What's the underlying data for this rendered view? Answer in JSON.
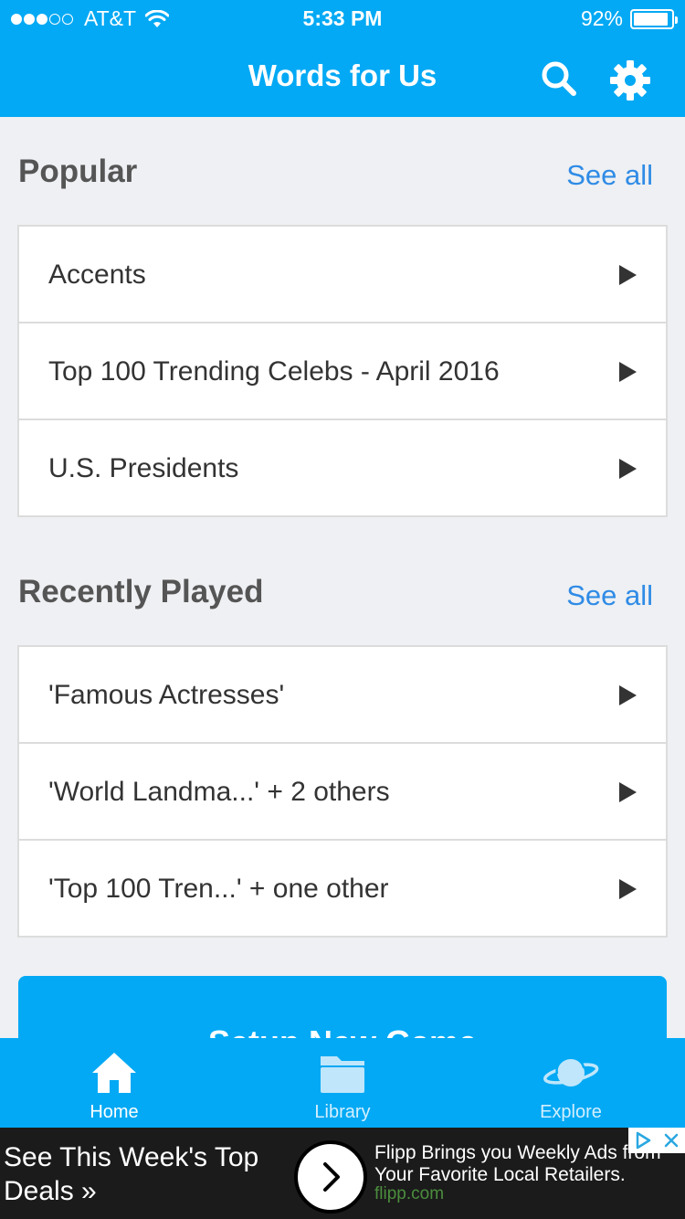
{
  "status_bar": {
    "carrier": "AT&T",
    "time": "5:33 PM",
    "battery": "92%",
    "battery_level": 0.92
  },
  "nav": {
    "title": "Words for Us"
  },
  "popular": {
    "title": "Popular",
    "see_all": "See all",
    "items": [
      {
        "label": "Accents"
      },
      {
        "label": "Top 100 Trending Celebs - April 2016"
      },
      {
        "label": "U.S. Presidents"
      }
    ]
  },
  "recent": {
    "title": "Recently Played",
    "see_all": "See all",
    "items": [
      {
        "label": "'Famous Actresses'"
      },
      {
        "label": "'World Landma...' + 2 others"
      },
      {
        "label": "'Top 100 Tren...' + one other"
      }
    ]
  },
  "setup_button": {
    "label": "Setup New Game"
  },
  "tabs": [
    {
      "label": "Home",
      "icon": "home-icon",
      "active": true
    },
    {
      "label": "Library",
      "icon": "folder-icon",
      "active": false
    },
    {
      "label": "Explore",
      "icon": "planet-icon",
      "active": false
    }
  ],
  "ad": {
    "headline": "See This Week's Top Deals »",
    "body_line1": "Flipp Brings you Weekly Ads from",
    "body_line2": "Your Favorite Local Retailers.",
    "domain": "flipp.com"
  },
  "colors": {
    "primary": "#03a9f4",
    "link": "#2f8be6",
    "background": "#eef0f3",
    "ad_background": "#1b1b1b"
  }
}
